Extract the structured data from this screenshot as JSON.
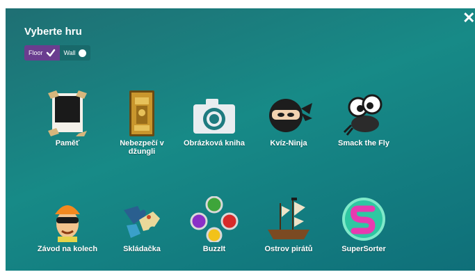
{
  "header": {
    "title": "Vyberte hru",
    "close_icon": "close-icon",
    "toggles": [
      {
        "label": "Floor",
        "state": "checked",
        "color": "#6a3d8f"
      },
      {
        "label": "Wall",
        "state": "unchecked"
      }
    ]
  },
  "games": [
    {
      "label": "Paměť",
      "icon": "polaroid-photo-icon"
    },
    {
      "label": "Nebezpečí v džungli",
      "icon": "golden-temple-card-icon"
    },
    {
      "label": "Obrázková kniha",
      "icon": "camera-icon"
    },
    {
      "label": "Kvíz-Ninja",
      "icon": "ninja-icon"
    },
    {
      "label": "Smack the Fly",
      "icon": "fly-icon"
    },
    {
      "label": "Závod na kolech",
      "icon": "cyclist-helmet-icon"
    },
    {
      "label": "Skládačka",
      "icon": "puzzle-pieces-icon"
    },
    {
      "label": "BuzzIt",
      "icon": "colored-buttons-icon"
    },
    {
      "label": "Ostrov pirátů",
      "icon": "pirate-ship-icon"
    },
    {
      "label": "SuperSorter",
      "icon": "supersorter-s-icon"
    }
  ],
  "colors": {
    "background": "#178a87",
    "floor_toggle": "#6a3d8f"
  }
}
